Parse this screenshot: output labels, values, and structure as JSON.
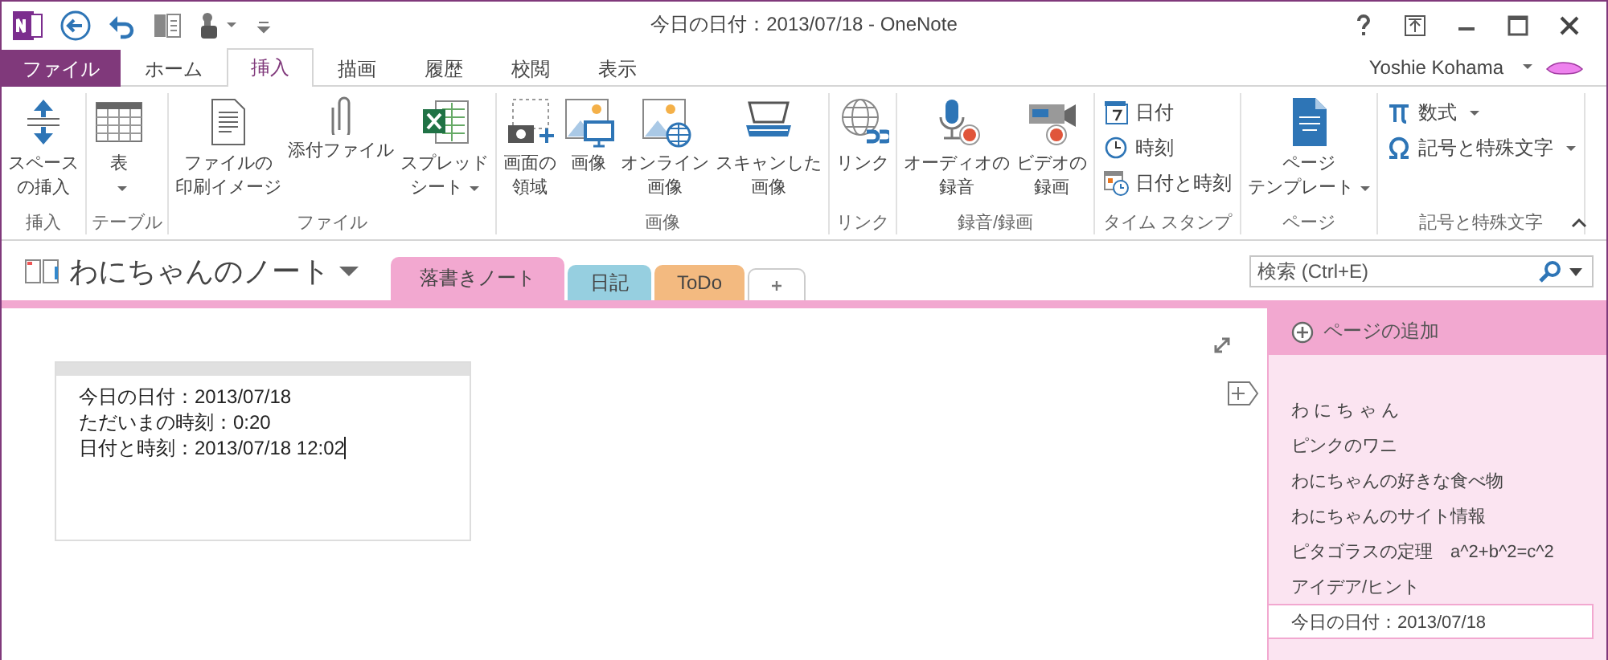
{
  "window": {
    "title": "今日の日付：2013/07/18 - OneNote"
  },
  "menu_tabs": [
    {
      "label": "ファイル",
      "kind": "file",
      "selected": false
    },
    {
      "label": "ホーム",
      "kind": "tab",
      "selected": false
    },
    {
      "label": "挿入",
      "kind": "tab",
      "selected": true
    },
    {
      "label": "描画",
      "kind": "tab",
      "selected": false
    },
    {
      "label": "履歴",
      "kind": "tab",
      "selected": false
    },
    {
      "label": "校閲",
      "kind": "tab",
      "selected": false
    },
    {
      "label": "表示",
      "kind": "tab",
      "selected": false
    }
  ],
  "user": {
    "name": "Yoshie Kohama"
  },
  "ribbon": {
    "groups": [
      {
        "label": "挿入",
        "buttons": [
          {
            "kind": "large",
            "lines": [
              "スペース",
              "の挿入"
            ],
            "dropdown": false
          }
        ]
      },
      {
        "label": "テーブル",
        "buttons": [
          {
            "kind": "large",
            "lines": [
              "表"
            ],
            "dropdown": true
          }
        ]
      },
      {
        "label": "ファイル",
        "buttons": [
          {
            "kind": "large",
            "lines": [
              "ファイルの",
              "印刷イメージ"
            ],
            "dropdown": false
          },
          {
            "kind": "large",
            "lines": [
              "添付ファイル"
            ],
            "dropdown": false
          },
          {
            "kind": "large",
            "lines": [
              "スプレッド",
              "シート"
            ],
            "dropdown": true
          }
        ]
      },
      {
        "label": "画像",
        "buttons": [
          {
            "kind": "large",
            "lines": [
              "画面の",
              "領域"
            ],
            "dropdown": false
          },
          {
            "kind": "large",
            "lines": [
              "画像"
            ],
            "dropdown": false
          },
          {
            "kind": "large",
            "lines": [
              "オンライン",
              "画像"
            ],
            "dropdown": false
          },
          {
            "kind": "large",
            "lines": [
              "スキャンした",
              "画像"
            ],
            "dropdown": false
          }
        ]
      },
      {
        "label": "リンク",
        "buttons": [
          {
            "kind": "large",
            "lines": [
              "リンク"
            ],
            "dropdown": false
          }
        ]
      },
      {
        "label": "録音/録画",
        "buttons": [
          {
            "kind": "large",
            "lines": [
              "オーディオの",
              "録音"
            ],
            "dropdown": false
          },
          {
            "kind": "large",
            "lines": [
              "ビデオの",
              "録画"
            ],
            "dropdown": false
          }
        ]
      },
      {
        "label": "タイム スタンプ",
        "buttons": [
          {
            "kind": "small",
            "lines": [
              "日付"
            ],
            "dropdown": false
          },
          {
            "kind": "small",
            "lines": [
              "時刻"
            ],
            "dropdown": false
          },
          {
            "kind": "small",
            "lines": [
              "日付と時刻"
            ],
            "dropdown": false
          }
        ]
      },
      {
        "label": "ページ",
        "buttons": [
          {
            "kind": "large",
            "lines": [
              "ページ",
              "テンプレート"
            ],
            "dropdown": true
          }
        ]
      },
      {
        "label": "記号と特殊文字",
        "buttons": [
          {
            "kind": "small",
            "lines": [
              "数式"
            ],
            "dropdown": true
          },
          {
            "kind": "small",
            "lines": [
              "記号と特殊文字"
            ],
            "dropdown": true
          }
        ]
      }
    ]
  },
  "notebook": {
    "name": "わにちゃんのノート",
    "sections": [
      {
        "label": "落書きノート",
        "color": "#f2a8d0",
        "selected": true
      },
      {
        "label": "日記",
        "color": "#96cfe0",
        "selected": false
      },
      {
        "label": "ToDo",
        "color": "#f3ba80",
        "selected": false
      }
    ]
  },
  "search": {
    "placeholder": "検索 (Ctrl+E)"
  },
  "note": {
    "lines": [
      "今日の日付：2013/07/18",
      "ただいまの時刻：0:20",
      "日付と時刻：2013/07/18 12:02"
    ]
  },
  "pages": {
    "add_label": "ページの追加",
    "items": [
      {
        "title": "わ に ち ゃ ん",
        "selected": false
      },
      {
        "title": "ピンクのワニ",
        "selected": false
      },
      {
        "title": "わにちゃんの好きな食べ物",
        "selected": false
      },
      {
        "title": "わにちゃんのサイト情報",
        "selected": false
      },
      {
        "title": "ピタゴラスの定理　a^2+b^2=c^2",
        "selected": false
      },
      {
        "title": "アイデア/ヒント",
        "selected": false
      },
      {
        "title": "今日の日付：2013/07/18",
        "selected": true
      }
    ]
  }
}
